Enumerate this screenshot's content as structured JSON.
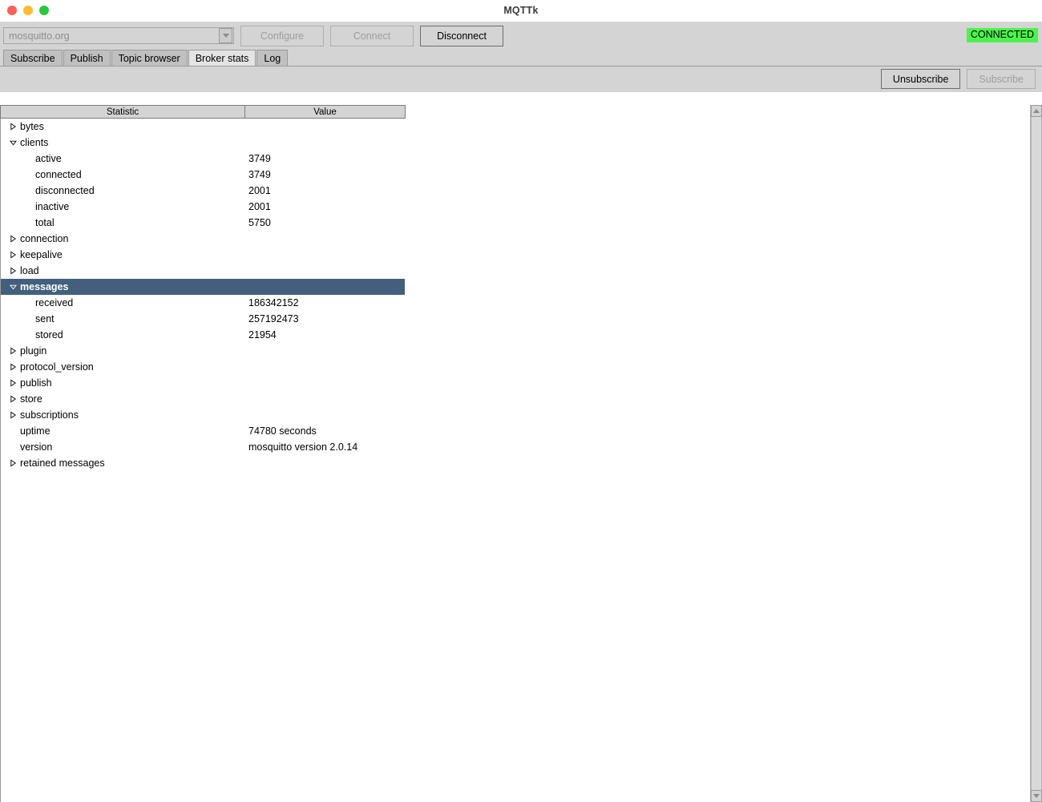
{
  "window": {
    "title": "MQTTk",
    "traffic_lights": [
      "close-button",
      "minimize-button",
      "maximize-button"
    ]
  },
  "connection_bar": {
    "broker_combo_value": "mosquitto.org",
    "broker_combo_placeholder": "mosquitto.org",
    "configure_label": "Configure",
    "connect_label": "Connect",
    "disconnect_label": "Disconnect",
    "status_label": "CONNECTED",
    "status_color": "#4cf34c"
  },
  "tabs": [
    {
      "label": "Subscribe",
      "active": false
    },
    {
      "label": "Publish",
      "active": false
    },
    {
      "label": "Topic browser",
      "active": false
    },
    {
      "label": "Broker stats",
      "active": true
    },
    {
      "label": "Log",
      "active": false
    }
  ],
  "sub_toolbar": {
    "unsubscribe_label": "Unsubscribe",
    "subscribe_label": "Subscribe"
  },
  "tree": {
    "columns": {
      "statistic": "Statistic",
      "value": "Value"
    },
    "selection_color": "#42607d",
    "rows": [
      {
        "label": "bytes",
        "value": "",
        "level": 0,
        "state": "collapsed",
        "selected": false
      },
      {
        "label": "clients",
        "value": "",
        "level": 0,
        "state": "expanded",
        "selected": false
      },
      {
        "label": "active",
        "value": "3749",
        "level": 1,
        "state": "leaf",
        "selected": false
      },
      {
        "label": "connected",
        "value": "3749",
        "level": 1,
        "state": "leaf",
        "selected": false
      },
      {
        "label": "disconnected",
        "value": "2001",
        "level": 1,
        "state": "leaf",
        "selected": false
      },
      {
        "label": "inactive",
        "value": "2001",
        "level": 1,
        "state": "leaf",
        "selected": false
      },
      {
        "label": "total",
        "value": "5750",
        "level": 1,
        "state": "leaf",
        "selected": false
      },
      {
        "label": "connection",
        "value": "",
        "level": 0,
        "state": "collapsed",
        "selected": false
      },
      {
        "label": "keepalive",
        "value": "",
        "level": 0,
        "state": "collapsed",
        "selected": false
      },
      {
        "label": "load",
        "value": "",
        "level": 0,
        "state": "collapsed",
        "selected": false
      },
      {
        "label": "messages",
        "value": "",
        "level": 0,
        "state": "expanded",
        "selected": true
      },
      {
        "label": "received",
        "value": "186342152",
        "level": 1,
        "state": "leaf",
        "selected": false
      },
      {
        "label": "sent",
        "value": "257192473",
        "level": 1,
        "state": "leaf",
        "selected": false
      },
      {
        "label": "stored",
        "value": "21954",
        "level": 1,
        "state": "leaf",
        "selected": false
      },
      {
        "label": "plugin",
        "value": "",
        "level": 0,
        "state": "collapsed",
        "selected": false
      },
      {
        "label": "protocol_version",
        "value": "",
        "level": 0,
        "state": "collapsed",
        "selected": false
      },
      {
        "label": "publish",
        "value": "",
        "level": 0,
        "state": "collapsed",
        "selected": false
      },
      {
        "label": "store",
        "value": "",
        "level": 0,
        "state": "collapsed",
        "selected": false
      },
      {
        "label": "subscriptions",
        "value": "",
        "level": 0,
        "state": "collapsed",
        "selected": false
      },
      {
        "label": "uptime",
        "value": "74780 seconds",
        "level": 0,
        "state": "leaf",
        "selected": false
      },
      {
        "label": "version",
        "value": "mosquitto version 2.0.14",
        "level": 0,
        "state": "leaf",
        "selected": false
      },
      {
        "label": "retained messages",
        "value": "",
        "level": 0,
        "state": "collapsed",
        "selected": false
      }
    ]
  },
  "scrollbar": {
    "up_icon": "scroll-up-arrow",
    "down_icon": "scroll-down-arrow"
  }
}
